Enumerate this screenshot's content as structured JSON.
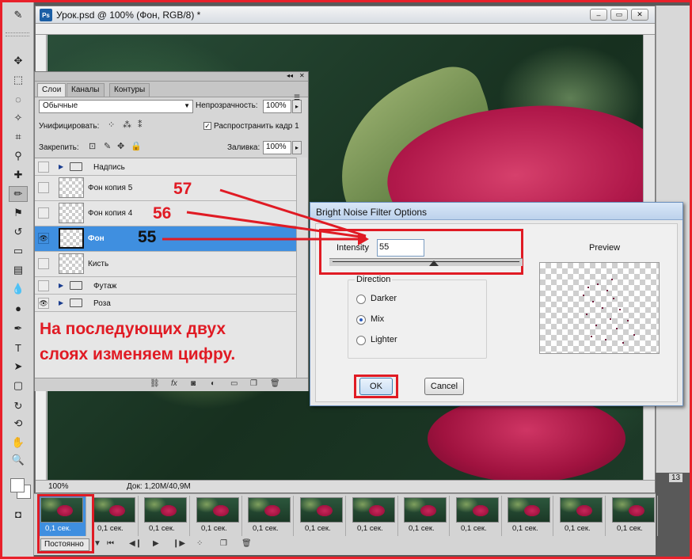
{
  "document": {
    "title": "Урок.psd @ 100% (Фон, RGB/8) *",
    "app_badge": "Ps",
    "zoom": "100%",
    "info": "Док: 1,20M/40,9M",
    "win_minimize": "–",
    "win_restore": "▭",
    "win_close": "✕"
  },
  "layers_panel": {
    "tabs": [
      {
        "label": "Слои"
      },
      {
        "label": "Каналы"
      },
      {
        "label": "Контуры"
      }
    ],
    "blend_mode": "Обычные",
    "opacity_label": "Непрозрачность:",
    "opacity_value": "100%",
    "unify_label": "Унифицировать:",
    "propagate_label": "Распространить кадр 1",
    "lock_label": "Закрепить:",
    "fill_label": "Заливка:",
    "fill_value": "100%",
    "layers": [
      {
        "name": "Надпись",
        "type": "group",
        "visible": false
      },
      {
        "name": "Фон копия 5",
        "type": "layer",
        "visible": false
      },
      {
        "name": "Фон копия 4",
        "type": "layer",
        "visible": false
      },
      {
        "name": "Фон",
        "type": "layer",
        "visible": true,
        "selected": true
      },
      {
        "name": "Кисть",
        "type": "layer",
        "visible": false
      },
      {
        "name": "Футаж",
        "type": "group",
        "visible": false
      },
      {
        "name": "Роза",
        "type": "group",
        "visible": true
      }
    ]
  },
  "annotations": {
    "n57": "57",
    "n56": "56",
    "n55": "55",
    "note_line1": "На последующих двух",
    "note_line2": "слоях изменяем цифру.",
    "color": "#e01b24"
  },
  "dialog": {
    "title": "Bright Noise Filter Options",
    "intensity_label": "Intensity",
    "intensity_value": "55",
    "intensity_slider": 0.55,
    "direction_label": "Direction",
    "options": [
      {
        "label": "Darker",
        "selected": false
      },
      {
        "label": "Mix",
        "selected": true
      },
      {
        "label": "Lighter",
        "selected": false
      }
    ],
    "preview_label": "Preview",
    "ok_label": "OK",
    "cancel_label": "Cancel"
  },
  "timeline": {
    "frame_delay": "0,1 сек.",
    "frame_count_visible": 12,
    "loop": "Постоянно",
    "edge_frame_number": "13"
  },
  "colors": {
    "selection": "#3f8fe0",
    "highlight_red": "#e01b24"
  }
}
